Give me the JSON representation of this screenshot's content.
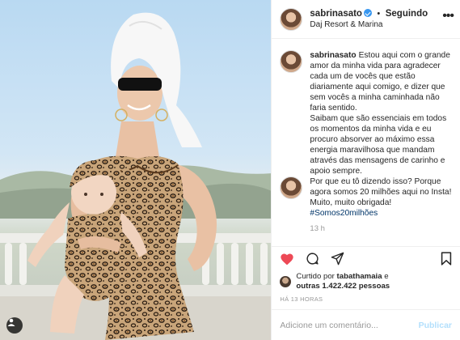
{
  "header": {
    "username": "sabrinasato",
    "separator": "•",
    "follow_status": "Seguindo",
    "location": "Daj Resort & Marina",
    "more": "•••"
  },
  "caption": {
    "username": "sabrinasato",
    "paragraphs": [
      "Estou aqui com o grande amor da minha vida para agradecer cada um de vocês que estão diariamente aqui comigo, e dizer que sem vocês a minha caminhada não faria sentido.",
      "Saibam que são essenciais em todos os momentos da minha vida e eu procuro absorver ao máximo essa energia maravilhosa que mandam através das mensagens de carinho e apoio sempre.",
      "Por que eu tô dizendo isso? Porque agora somos 20 milhões aqui no Insta!",
      "Muito, muito obrigada!"
    ],
    "hashtag": "#Somos20milhões",
    "age": "13 h"
  },
  "likes": {
    "prefix": "Curtido por",
    "user": "tabathamaia",
    "connector": "e",
    "others": "outras 1.422.422 pessoas"
  },
  "timestamp": "HÁ 13 HORAS",
  "comment_input": {
    "placeholder": "Adicione um comentário..."
  },
  "publish_label": "Publicar",
  "colors": {
    "link": "#003569",
    "verified": "#3897f0",
    "like": "#ed4956",
    "publish": "#b2dffc"
  }
}
